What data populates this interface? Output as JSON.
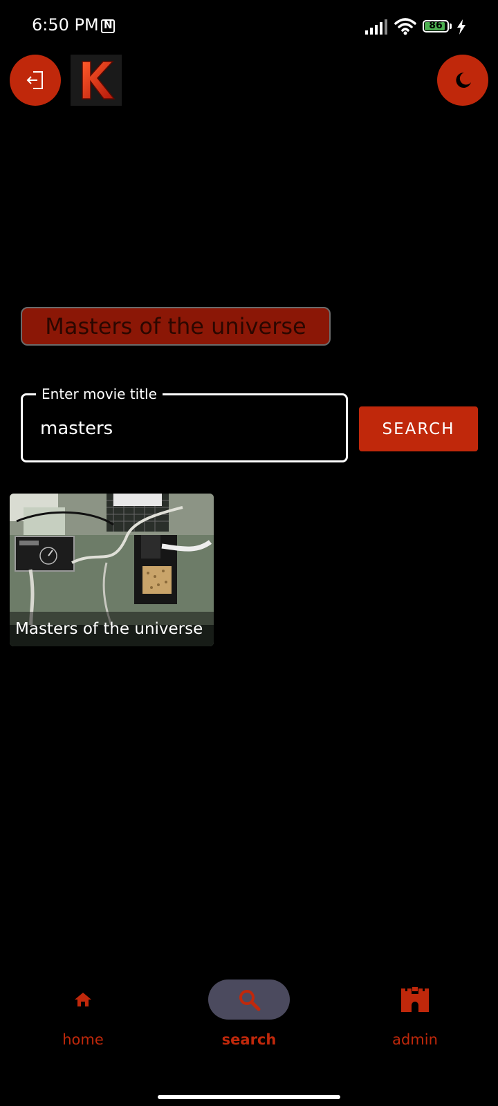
{
  "status_bar": {
    "time": "6:50 PM",
    "battery_level": "86",
    "battery_fraction": 0.86,
    "icons": [
      "nfc-icon",
      "signal-icon",
      "wifi-icon",
      "battery-icon",
      "charging-icon"
    ]
  },
  "header": {
    "logo_letter": "K",
    "logout_icon": "logout-icon",
    "theme_icon": "moon-icon"
  },
  "title_pill": {
    "text": "Masters of the universe"
  },
  "search": {
    "field_label": "Enter movie title",
    "value": "masters",
    "button_label": "SEARCH"
  },
  "results": [
    {
      "title": "Masters of the universe"
    }
  ],
  "bottom_nav": {
    "items": [
      {
        "label": "home",
        "icon": "home-icon",
        "active": false
      },
      {
        "label": "search",
        "icon": "search-icon",
        "active": true
      },
      {
        "label": "admin",
        "icon": "castle-icon",
        "active": false
      }
    ]
  },
  "colors": {
    "accent": "#c0280b",
    "background": "#000000",
    "title_pill_bg": "#8b1706",
    "nav_active_bg": "#4b4a5e",
    "battery_green": "#4caf50"
  }
}
